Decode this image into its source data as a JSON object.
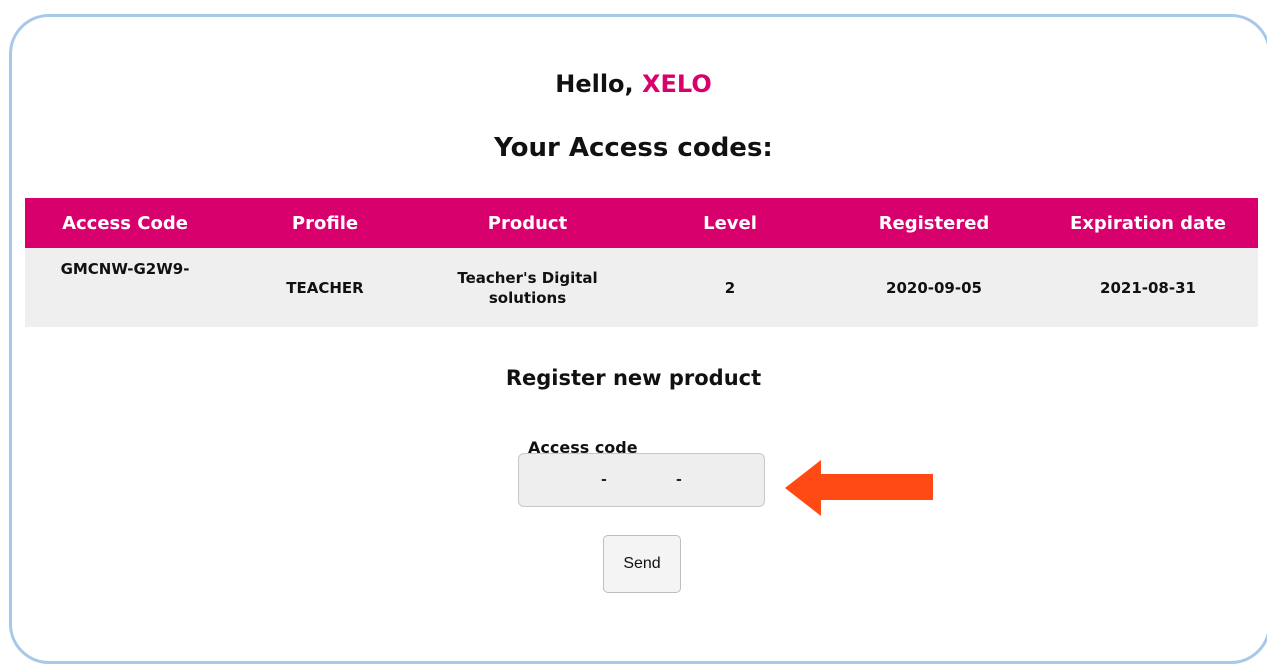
{
  "greeting": {
    "prefix": "Hello, ",
    "user": "XELO"
  },
  "codes_title": "Your Access codes:",
  "table": {
    "headers": [
      "Access Code",
      "Profile",
      "Product",
      "Level",
      "Registered",
      "Expiration date"
    ],
    "rows": [
      [
        "GMCNW-G2W9-",
        "TEACHER",
        "Teacher's Digital solutions",
        "2",
        "2020-09-05",
        "2021-08-31"
      ]
    ]
  },
  "register": {
    "title": "Register new product",
    "field_label": "Access code",
    "field_value": "",
    "separator": "-",
    "send_label": "Send"
  },
  "colors": {
    "accent": "#d8006c",
    "arrow": "#ff4a14",
    "card_border": "#a8c8ea",
    "row_bg": "#efefef"
  },
  "icons": {
    "pointer": "arrow-left-icon"
  }
}
